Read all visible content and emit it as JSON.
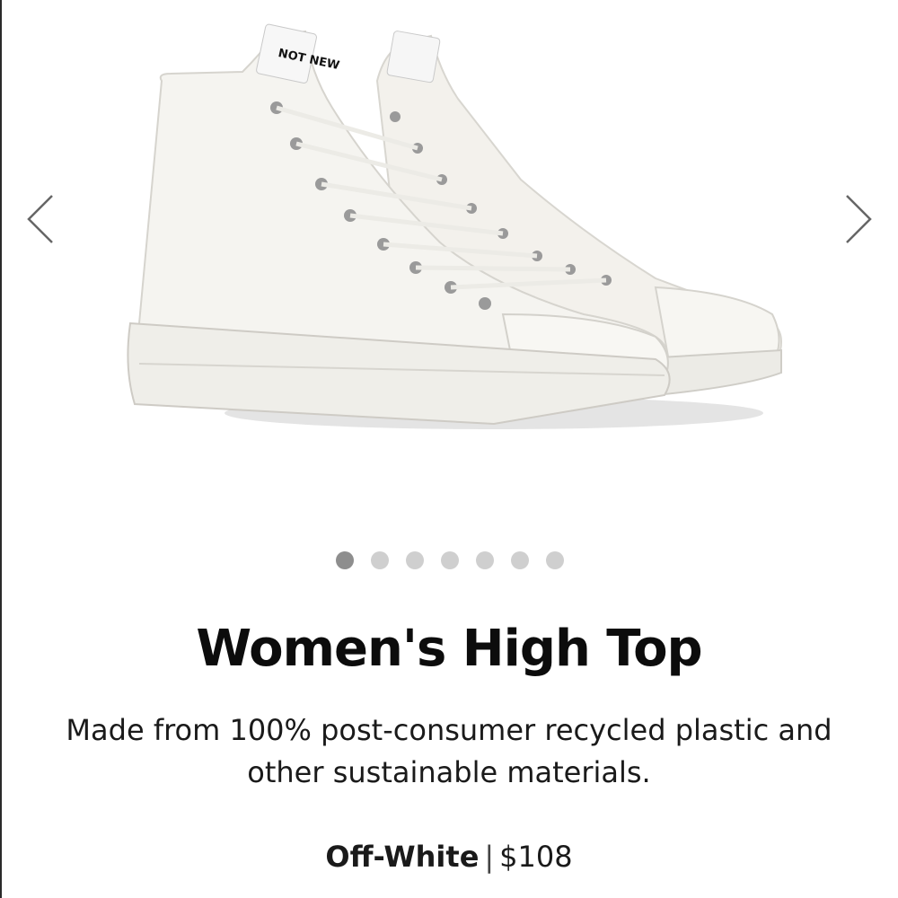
{
  "carousel": {
    "prev_icon": "chevron-left-icon",
    "next_icon": "chevron-right-icon",
    "slide_count": 7,
    "active_index": 0,
    "image": {
      "label_text": "NOT NEW"
    }
  },
  "product": {
    "title": "Women's High Top",
    "description": "Made from 100% post-consumer recycled plastic and other sustainable materials.",
    "color": "Off-White",
    "separator": "|",
    "price": "$108"
  },
  "colors": {
    "background": "#ffffff",
    "text": "#111111",
    "dot_active": "#8e8e8e",
    "dot_inactive": "#cfcfcf"
  }
}
